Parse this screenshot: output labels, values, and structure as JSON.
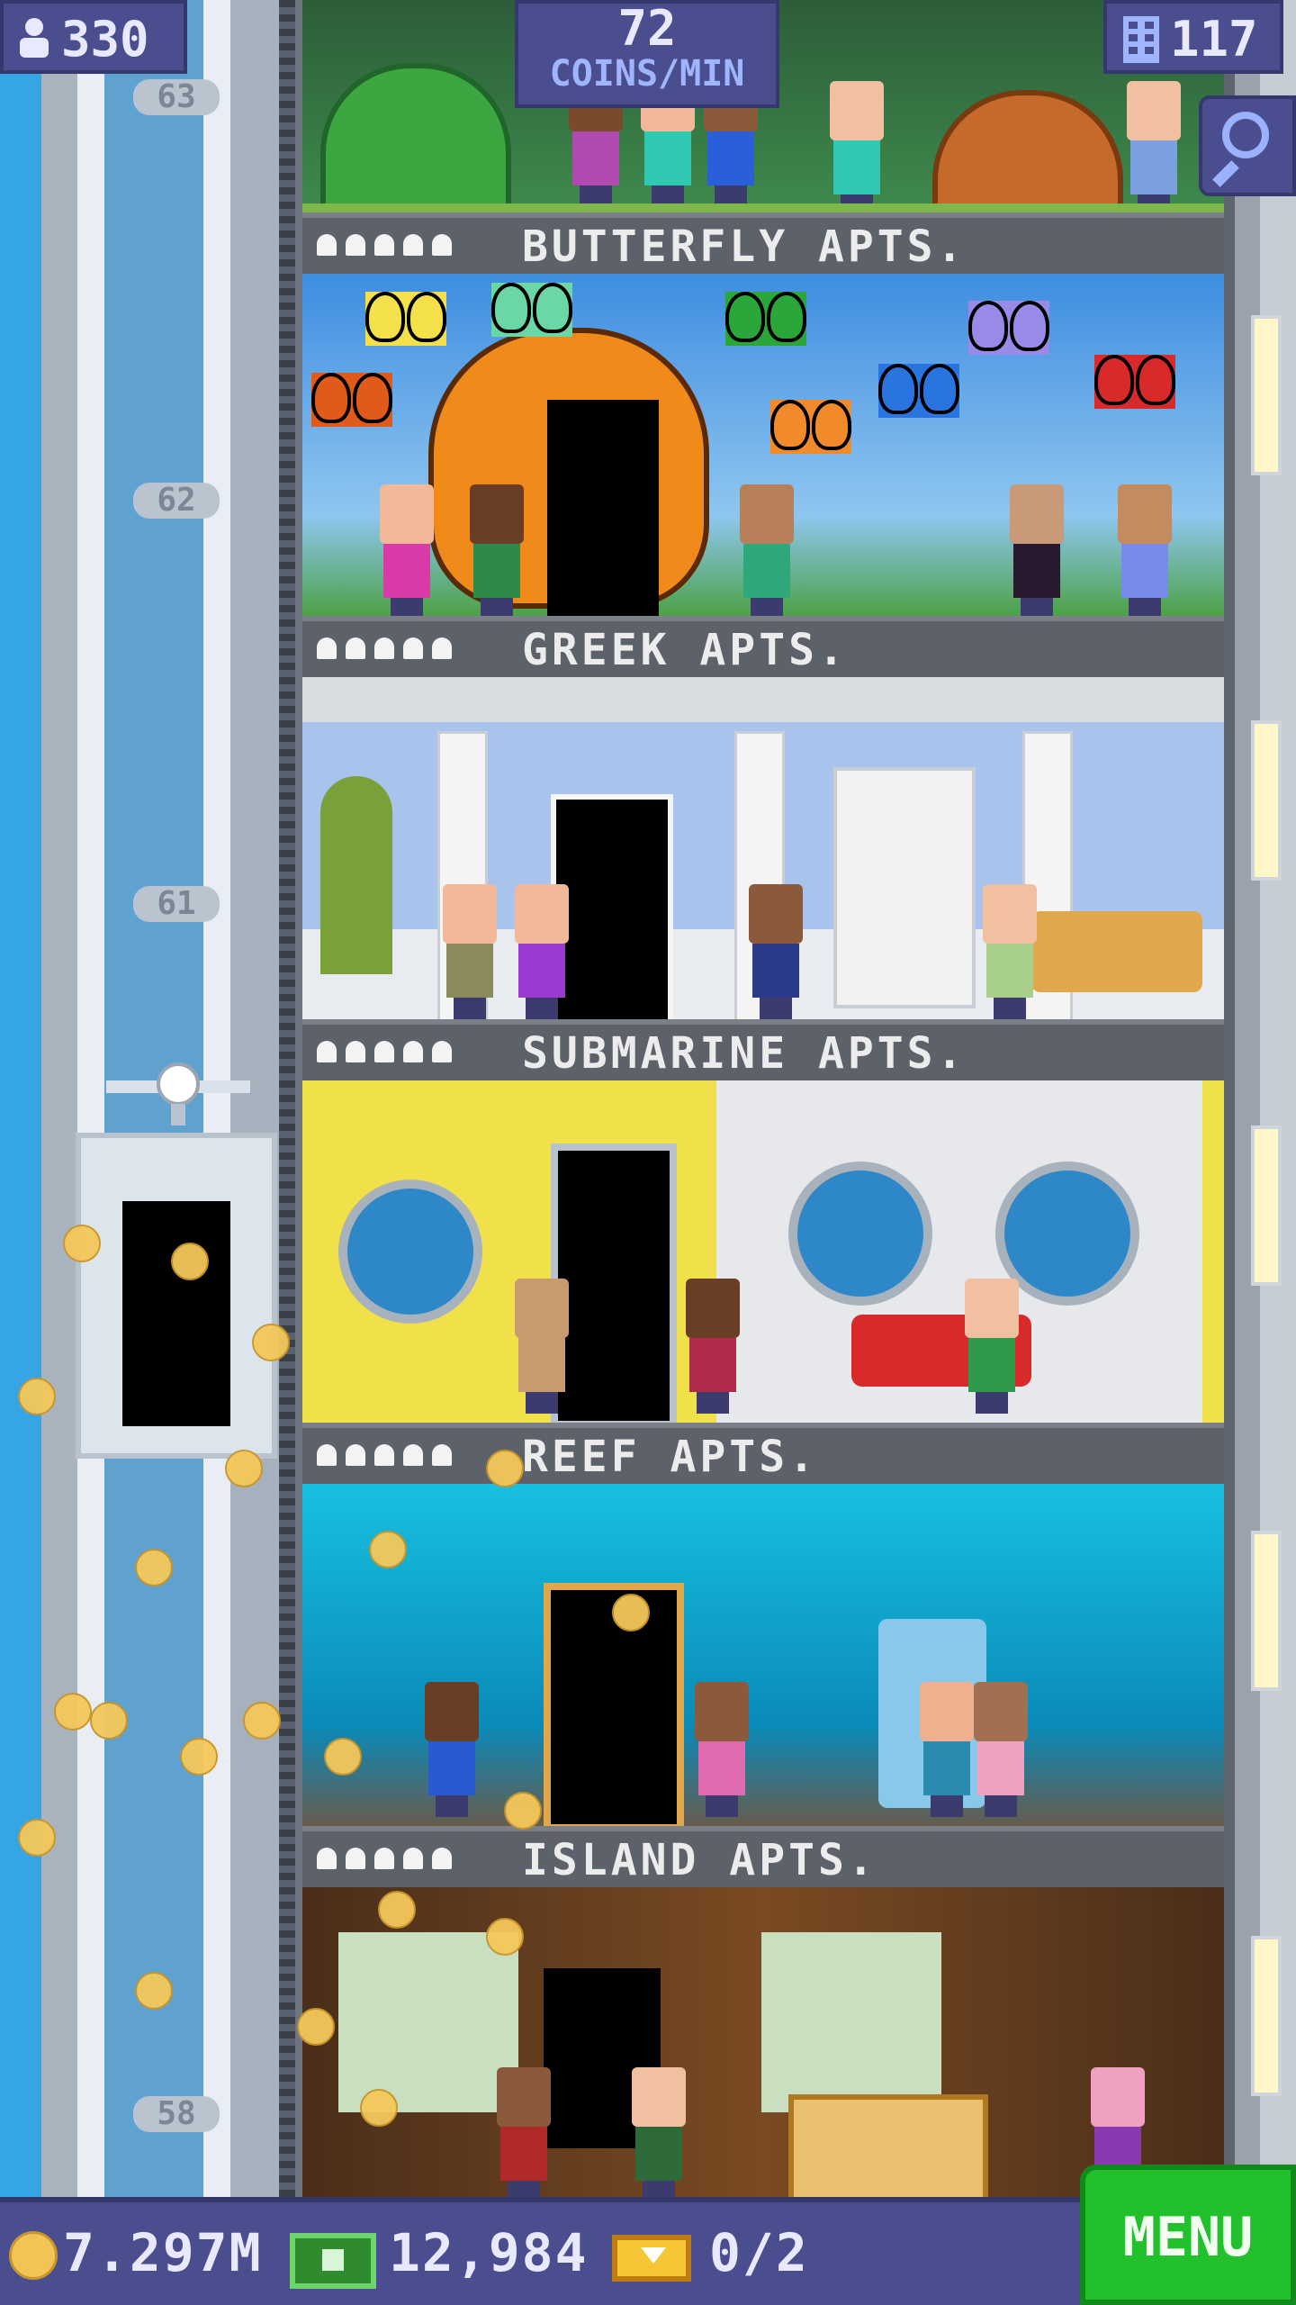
{
  "hud": {
    "population": "330",
    "coins_rate_value": "72",
    "coins_rate_unit": "COINS/MIN",
    "floor_count": "117"
  },
  "icons": {
    "population": "person-icon",
    "floors": "building-icon",
    "search": "magnifier-icon",
    "coins": "coin-icon",
    "bux": "cash-icon",
    "tickets": "ticket-icon"
  },
  "elevator": {
    "floor_numbers": [
      "63",
      "62",
      "61",
      "58"
    ]
  },
  "floors": [
    {
      "name": "BUTTERFLY APTS."
    },
    {
      "name": "GREEK APTS."
    },
    {
      "name": "SUBMARINE APTS."
    },
    {
      "name": "REEF APTS."
    },
    {
      "name": "ISLAND APTS."
    }
  ],
  "bottom": {
    "coins": "7.297M",
    "bux": "12,984",
    "tickets": "0/2",
    "menu_label": "MENU"
  },
  "colors": {
    "hud_bg": "#4b4e8e",
    "menu_green": "#21c02c",
    "sky": "#36a5e6"
  }
}
